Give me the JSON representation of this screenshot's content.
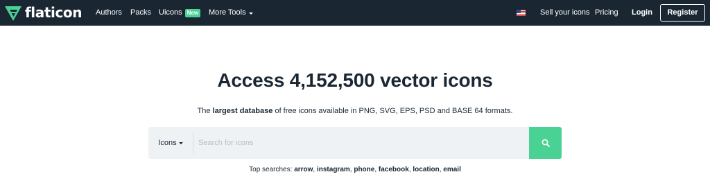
{
  "header": {
    "logo_text": "flaticon",
    "nav": {
      "authors": "Authors",
      "packs": "Packs",
      "uicons": "Uicons",
      "uicons_badge": "New",
      "more_tools": "More Tools"
    },
    "right": {
      "language_flag": "us-flag-icon",
      "sell": "Sell your icons",
      "pricing": "Pricing",
      "login": "Login",
      "register": "Register"
    }
  },
  "hero": {
    "title": "Access 4,152,500 vector icons",
    "subtitle_prefix": "The ",
    "subtitle_bold": "largest database",
    "subtitle_suffix": " of free icons available in PNG, SVG, EPS, PSD and BASE 64 formats."
  },
  "search": {
    "type_selected": "Icons",
    "placeholder": "Search for icons",
    "button_icon": "search-icon"
  },
  "top_searches": {
    "label": "Top searches:",
    "terms": [
      "arrow",
      "instagram",
      "phone",
      "facebook",
      "location",
      "email"
    ]
  },
  "colors": {
    "header_bg": "#1a2733",
    "accent": "#4ad295",
    "search_bg": "#eef2f5",
    "text": "#1a2733"
  }
}
